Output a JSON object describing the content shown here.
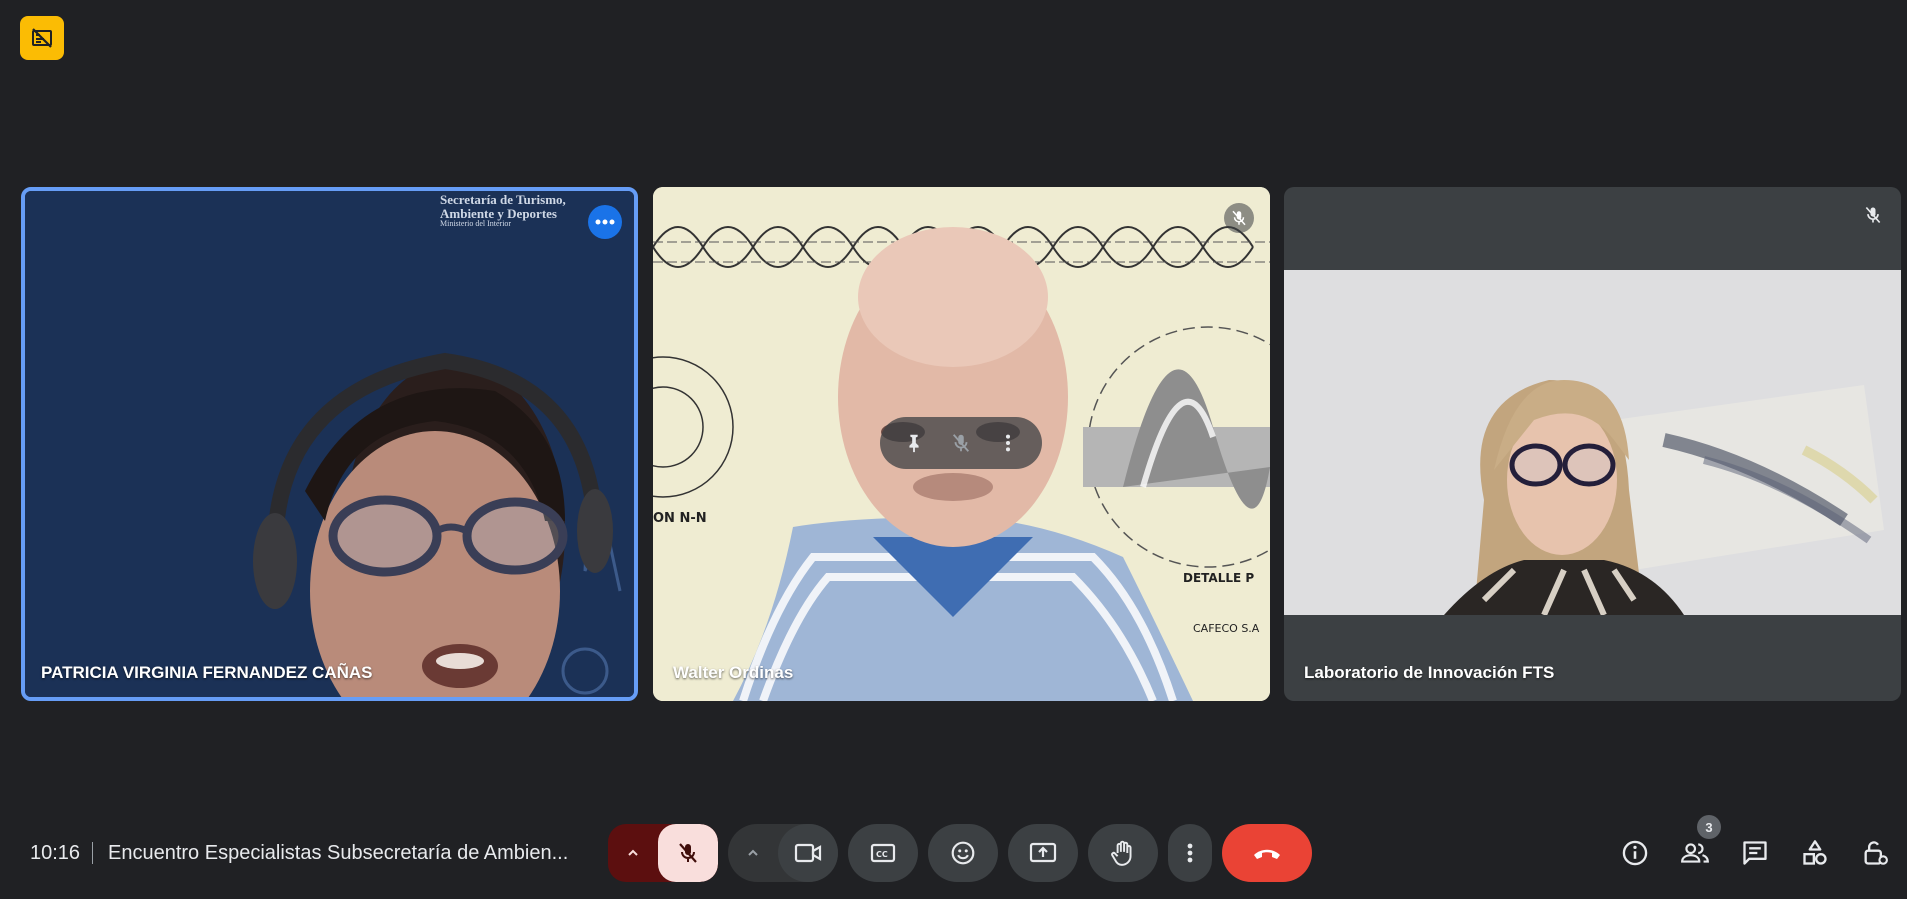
{
  "colors": {
    "background": "#202124",
    "speaking_border": "#669df6",
    "control_bg": "#3c4043",
    "mic_off_bg": "#f9dedc",
    "end_call": "#ea4335",
    "warning_badge": "#fbbc04"
  },
  "top": {
    "badge_icon": "no-video-warning-icon"
  },
  "tiles": [
    {
      "name": "PATRICIA VIRGINIA FERNANDEZ CAÑAS",
      "background_lines": [
        "Secretaría de Turismo,",
        "Ambiente y Deportes",
        "Ministerio del Interior"
      ],
      "icon": "more-options-icon"
    },
    {
      "name": "Walter Ordinas",
      "icons": [
        "mic-off-icon",
        "pin-icon",
        "mic-off-icon",
        "more-vert-icon"
      ]
    },
    {
      "name": "Laboratorio de Innovación FTS",
      "icon": "mic-off-icon"
    }
  ],
  "bottom_bar": {
    "time": "10:16",
    "meeting_title": "Encuentro Especialistas Subsecretaría de Ambien...",
    "controls": [
      "chevron-up-icon",
      "mic-off-icon",
      "chevron-up-icon",
      "videocam-icon",
      "closed-captions-icon",
      "emoji-icon",
      "present-screen-icon",
      "raise-hand-icon",
      "more-vert-icon",
      "call-end-icon"
    ],
    "right_icons": [
      "info-icon",
      "people-icon",
      "chat-icon",
      "activities-icon",
      "host-controls-icon"
    ],
    "people_count": "3"
  }
}
